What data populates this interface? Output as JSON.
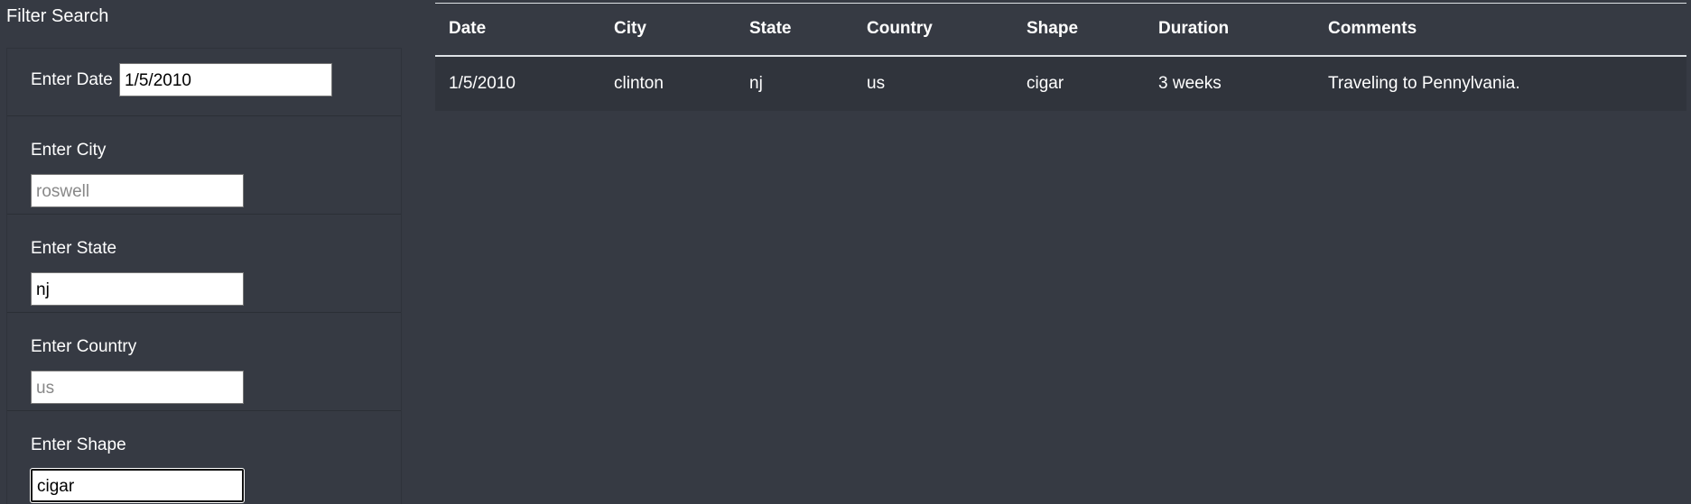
{
  "sidebar": {
    "title": "Filter Search",
    "filters": [
      {
        "label": "Enter Date",
        "value": "1/5/2010",
        "placeholder": ""
      },
      {
        "label": "Enter City",
        "value": "",
        "placeholder": "roswell"
      },
      {
        "label": "Enter State",
        "value": "nj",
        "placeholder": ""
      },
      {
        "label": "Enter Country",
        "value": "",
        "placeholder": "us"
      },
      {
        "label": "Enter Shape",
        "value": "cigar",
        "placeholder": ""
      }
    ]
  },
  "table": {
    "headers": [
      "Date",
      "City",
      "State",
      "Country",
      "Shape",
      "Duration",
      "Comments"
    ],
    "rows": [
      [
        "1/5/2010",
        "clinton",
        "nj",
        "us",
        "cigar",
        "3 weeks",
        "Traveling to Pennylvania."
      ]
    ]
  },
  "colors": {
    "background": "#363a43",
    "row_background": "#30343c",
    "text": "#ffffff"
  }
}
